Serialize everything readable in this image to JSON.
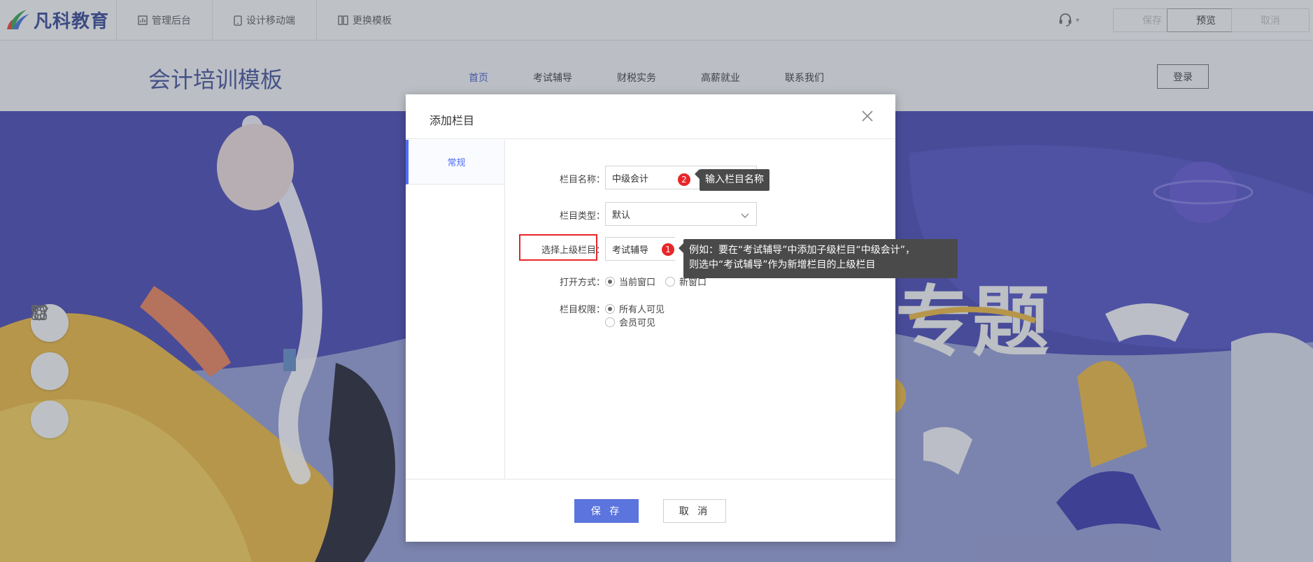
{
  "topbar": {
    "logo_text": "凡科教育",
    "nav": [
      {
        "label": "管理后台",
        "icon": "chart-icon"
      },
      {
        "label": "设计移动端",
        "icon": "mobile-icon"
      },
      {
        "label": "更换模板",
        "icon": "template-icon"
      }
    ],
    "save_label": "保存",
    "preview_label": "预览",
    "cancel_label": "取消"
  },
  "site": {
    "title": "会计培训模板",
    "nav": [
      "首页",
      "考试辅导",
      "财税实务",
      "高薪就业",
      "联系我们"
    ],
    "login_label": "登录",
    "banner_text": "专题"
  },
  "dialog": {
    "title": "添加栏目",
    "tab_general": "常规",
    "name_label": "栏目名称：",
    "name_value": "中级会计",
    "type_label": "栏目类型：",
    "type_value": "默认",
    "parent_label": "选择上级栏目：",
    "parent_value": "考试辅导",
    "open_label": "打开方式：",
    "open_options": [
      "当前窗口",
      "新窗口"
    ],
    "perm_label": "栏目权限：",
    "perm_options": [
      "所有人可见",
      "会员可见"
    ],
    "save_label": "保 存",
    "cancel_label": "取 消"
  },
  "annotations": {
    "badge1": "1",
    "badge2": "2",
    "tip_name": "输入栏目名称",
    "tip_parent_line1": "例如：要在“考试辅导”中添加子级栏目“中级会计”，",
    "tip_parent_line2": "则选中“考试辅导”作为新增栏目的上级栏目"
  },
  "colors": {
    "accent": "#4e6ef2",
    "highlight": "#e8262a",
    "tooltip": "#4a4a4a"
  }
}
